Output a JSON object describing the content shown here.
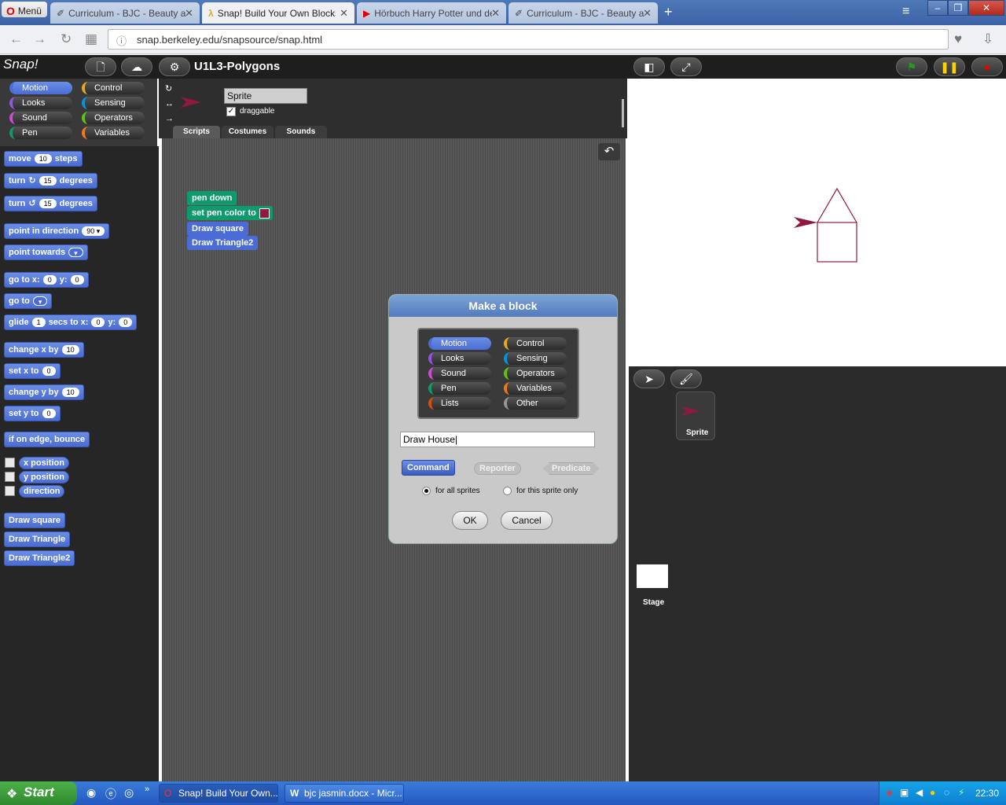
{
  "browser": {
    "menu_label": "Menü",
    "tabs": [
      {
        "label": "Curriculum - BJC - Beauty and Joy of Computing"
      },
      {
        "label": "Snap! Build Your Own Blocks"
      },
      {
        "label": "Hörbuch Harry Potter und der"
      },
      {
        "label": "Curriculum - BJC - Beauty and Joy of Computing"
      }
    ],
    "url": "snap.berkeley.edu/snapsource/snap.html"
  },
  "snap": {
    "logo": "Snap!",
    "project_name": "U1L3-Polygons",
    "categories": {
      "motion": "Motion",
      "looks": "Looks",
      "sound": "Sound",
      "pen": "Pen",
      "control": "Control",
      "sensing": "Sensing",
      "operators": "Operators",
      "variables": "Variables"
    },
    "palette": {
      "move": "move",
      "move_val": "10",
      "steps": "steps",
      "turn": "turn",
      "turn_cw_val": "15",
      "turn_ccw_val": "15",
      "degrees": "degrees",
      "point_dir": "point in direction",
      "point_dir_val": "90",
      "point_towards": "point towards",
      "goto_xy": "go to x:",
      "goto_x": "0",
      "y_label": "y:",
      "goto_y": "0",
      "goto": "go to",
      "glide": "glide",
      "glide_secs": "1",
      "secs_to_x": "secs to x:",
      "glide_x": "0",
      "glide_y": "0",
      "change_x": "change x by",
      "change_x_val": "10",
      "set_x": "set x to",
      "set_x_val": "0",
      "change_y": "change y by",
      "change_y_val": "10",
      "set_y": "set y to",
      "set_y_val": "0",
      "bounce": "if on edge, bounce",
      "x_position": "x position",
      "y_position": "y position",
      "direction": "direction",
      "custom1": "Draw square",
      "custom2": "Draw Triangle",
      "custom3": "Draw Triangle2"
    },
    "sprite": {
      "name": "Sprite",
      "draggable_label": "draggable",
      "tabs": {
        "scripts": "Scripts",
        "costumes": "Costumes",
        "sounds": "Sounds"
      }
    },
    "script": {
      "b1": "pen down",
      "b2": "set pen color to",
      "b3": "Draw square",
      "b4": "Draw Triangle2"
    },
    "corral": {
      "sprite_label": "Sprite",
      "stage_label": "Stage"
    }
  },
  "dialog": {
    "title": "Make a block",
    "categories": {
      "motion": "Motion",
      "looks": "Looks",
      "sound": "Sound",
      "pen": "Pen",
      "lists": "Lists",
      "control": "Control",
      "sensing": "Sensing",
      "operators": "Operators",
      "variables": "Variables",
      "other": "Other"
    },
    "name_value": "Draw House",
    "types": {
      "command": "Command",
      "reporter": "Reporter",
      "predicate": "Predicate"
    },
    "scope": {
      "all": "for all sprites",
      "this": "for this sprite only"
    },
    "ok": "OK",
    "cancel": "Cancel"
  },
  "taskbar": {
    "start": "Start",
    "items": [
      {
        "label": "Snap! Build Your Own..."
      },
      {
        "label": "bjc jasmin.docx - Micr..."
      }
    ],
    "clock": "22:30"
  },
  "colors": {
    "motion": "#4a6cd4",
    "looks": "#8f56e3",
    "sound": "#cf4ad9",
    "pen": "#0e9a6c",
    "control": "#e6a822",
    "sensing": "#0494dc",
    "operators": "#62c213",
    "variables": "#f3761d",
    "lists": "#d94d11",
    "other": "#969696",
    "pen_color": "#8f1a3e"
  }
}
